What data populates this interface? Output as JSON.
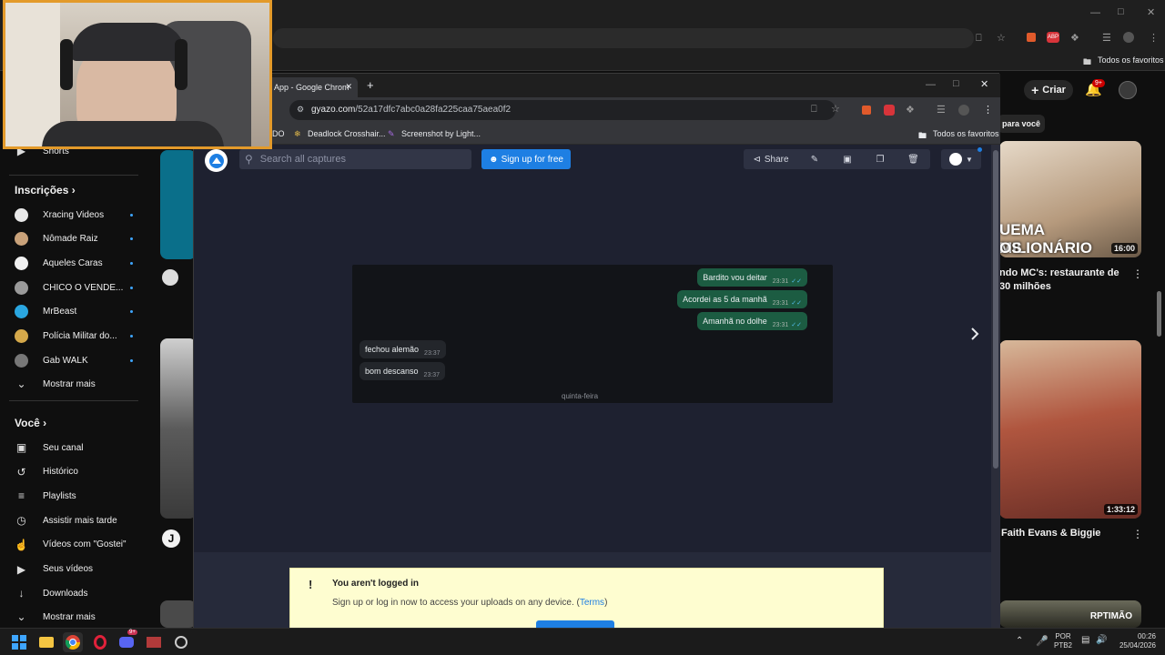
{
  "background_window": {
    "bookmark_all": "Todos os favoritos",
    "create_label": "Criar",
    "notif_badge": "9+",
    "chip_label": "para você"
  },
  "sidebar": {
    "shorts_label": "Shorts",
    "subscriptions_heading": "Inscrições",
    "channels": [
      {
        "name": "Xracing Videos",
        "color": "#e8e8e8"
      },
      {
        "name": "Nômade Raiz",
        "color": "#c9a27a"
      },
      {
        "name": "Aqueles Caras",
        "color": "#f0f0f0"
      },
      {
        "name": "CHICO O VENDE...",
        "color": "#9a9a9a"
      },
      {
        "name": "MrBeast",
        "color": "#2aa6e0"
      },
      {
        "name": "Polícia Militar do...",
        "color": "#d4a84a"
      },
      {
        "name": "Gab WALK",
        "color": "#777777"
      }
    ],
    "show_more_1": "Mostrar mais",
    "you_heading": "Você",
    "you_items": [
      {
        "label": "Seu canal",
        "icon": "person-box-icon"
      },
      {
        "label": "Histórico",
        "icon": "history-icon"
      },
      {
        "label": "Playlists",
        "icon": "playlist-icon"
      },
      {
        "label": "Assistir mais tarde",
        "icon": "clock-icon"
      },
      {
        "label": "Vídeos com \"Gostei\"",
        "icon": "thumb-up-icon"
      },
      {
        "label": "Seus vídeos",
        "icon": "video-icon"
      },
      {
        "label": "Downloads",
        "icon": "download-icon"
      }
    ],
    "show_more_2": "Mostrar mais"
  },
  "right_column": {
    "video1_title_banner": "UEMA MILIONÁRIO",
    "video1_title_banner2": "OS",
    "video1_duration": "16:00",
    "video1_title": "ndo MC's: restaurante de",
    "video1_title2": "30 milhões",
    "video2_duration": "1:33:12",
    "video2_title": "Faith Evans & Biggie",
    "video3_watermark": "RPTIMÃO"
  },
  "gyazo_window": {
    "tab_title": "App - Google Chrom",
    "url_host": "gyazo.com",
    "url_path": "/52a17dfc7abc0a28fa225caa75aea0f2",
    "bookmarks": [
      "DO",
      "Deadlock Crosshair...",
      "Screenshot by Light..."
    ],
    "bookmark_all": "Todos os favoritos",
    "search_placeholder": "Search all captures",
    "signup_label": "Sign up for free",
    "share_label": "Share",
    "chat": {
      "outgoing": [
        {
          "text": "Bardito vou deitar",
          "time": "23:31"
        },
        {
          "text": "Acordei as 5 da manhã",
          "time": "23:31"
        },
        {
          "text": "Amanhã no dolhe",
          "time": "23:31"
        }
      ],
      "incoming": [
        {
          "text": "fechou alemão",
          "time": "23:37"
        },
        {
          "text": "bom descanso",
          "time": "23:37"
        }
      ],
      "day_label": "quinta-feira"
    },
    "notice_title": "You aren't logged in",
    "notice_body": "Sign up or log in now to access your uploads on any device.",
    "notice_link": "Terms"
  },
  "taskbar": {
    "lang1": "POR",
    "lang2": "PTB2",
    "time": "00:26",
    "date": "25/04/2026",
    "discord_badge": "9+"
  }
}
